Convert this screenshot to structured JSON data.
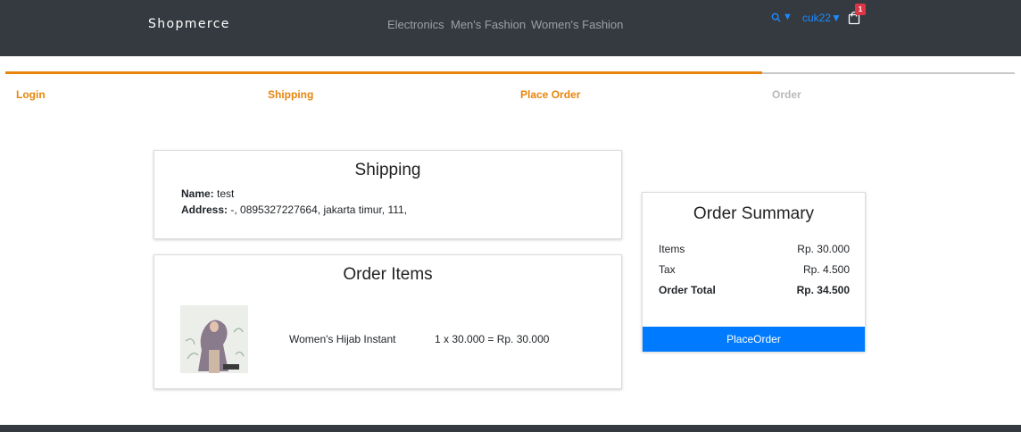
{
  "navbar": {
    "brand": "Shopmerce",
    "links": [
      "Electronics",
      "Men's Fashion",
      "Women's Fashion"
    ],
    "search_icon": "search-icon",
    "search_caret": "▼",
    "user_label": "cuk22▼",
    "cart_icon": "shopping-bag-icon",
    "cart_count": "1"
  },
  "steps": [
    {
      "label": "Login",
      "status": "done"
    },
    {
      "label": "Shipping",
      "status": "done"
    },
    {
      "label": "Place Order",
      "status": "active"
    },
    {
      "label": "Order",
      "status": "inactive"
    }
  ],
  "shipping": {
    "title": "Shipping",
    "name_label": "Name:",
    "name_value": " test",
    "address_label": "Address:",
    "address_value": " -, 0895327227664, jakarta timur, 111,"
  },
  "order_items": {
    "title": "Order Items",
    "items": [
      {
        "name": "Women's Hijab Instant",
        "price": "1 x 30.000 = Rp. 30.000"
      }
    ]
  },
  "summary": {
    "title": "Order Summary",
    "rows": [
      {
        "label": "Items",
        "value": "Rp. 30.000"
      },
      {
        "label": "Tax",
        "value": "Rp. 4.500"
      },
      {
        "label": "Order Total",
        "value": "Rp. 34.500"
      }
    ],
    "button_label": "PlaceOrder"
  },
  "colors": {
    "navbar": "#343a40",
    "accent": "#e8850c",
    "inactive": "#b8b8b8",
    "primary": "#007bff",
    "badge": "#dc3545"
  }
}
